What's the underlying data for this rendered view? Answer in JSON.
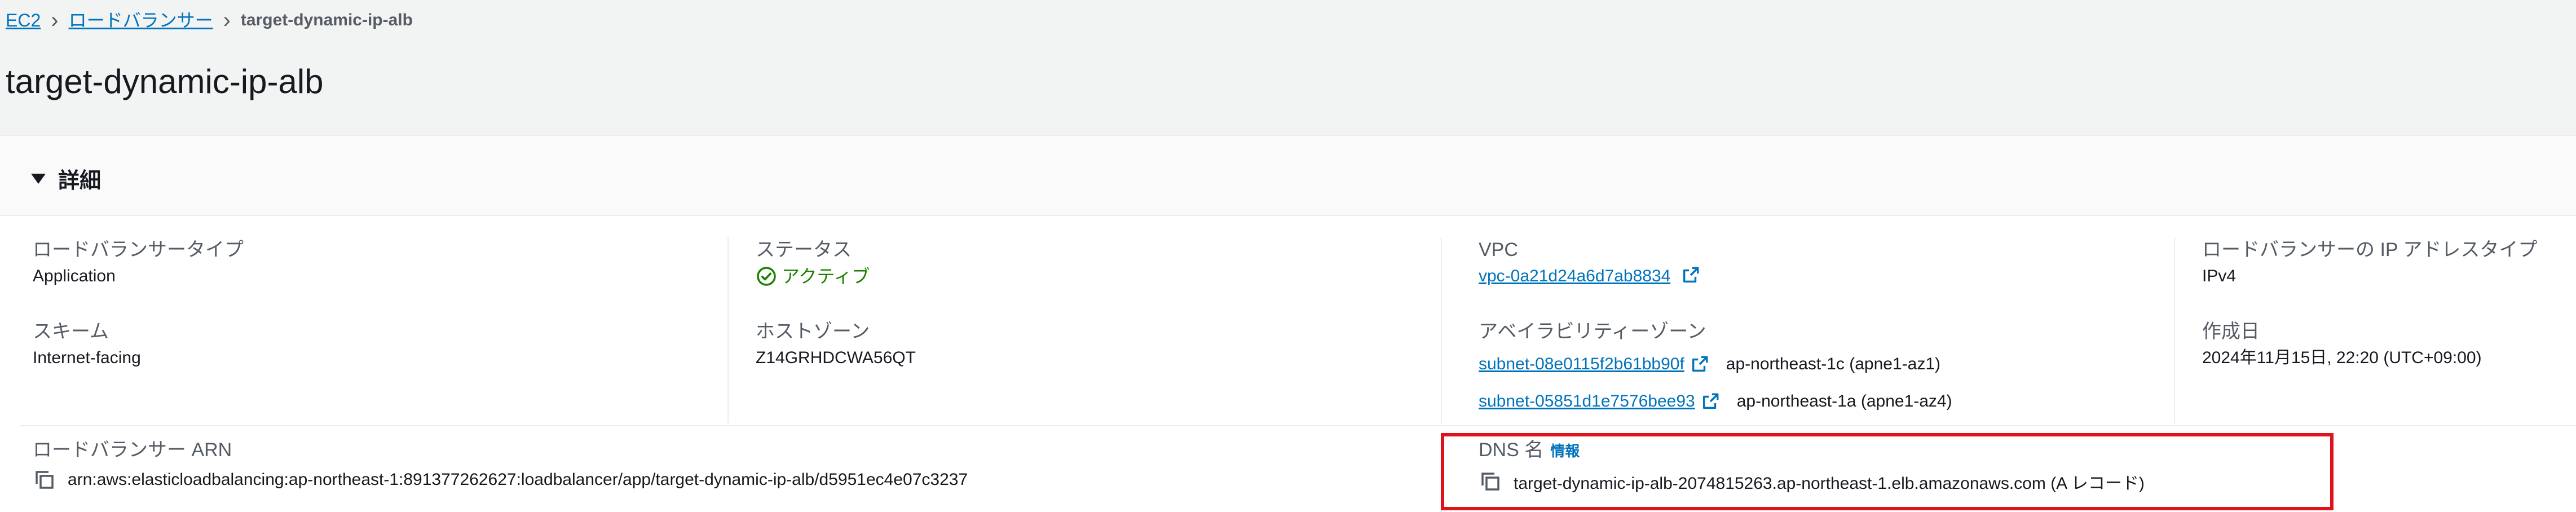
{
  "breadcrumb": {
    "items": [
      "EC2",
      "ロードバランサー"
    ],
    "current": "target-dynamic-ip-alb"
  },
  "page": {
    "title": "target-dynamic-ip-alb"
  },
  "details": {
    "section_title": "詳細",
    "lb_type": {
      "label": "ロードバランサータイプ",
      "value": "Application"
    },
    "scheme": {
      "label": "スキーム",
      "value": "Internet-facing"
    },
    "status": {
      "label": "ステータス",
      "value": "アクティブ",
      "color": "#1d8102"
    },
    "hosted_zone": {
      "label": "ホストゾーン",
      "value": "Z14GRHDCWA56QT"
    },
    "vpc": {
      "label": "VPC",
      "value": "vpc-0a21d24a6d7ab8834"
    },
    "availability_zones": {
      "label": "アベイラビリティーゾーン",
      "items": [
        {
          "subnet": "subnet-08e0115f2b61bb90f",
          "zone": "ap-northeast-1c (apne1-az1)"
        },
        {
          "subnet": "subnet-05851d1e7576bee93",
          "zone": "ap-northeast-1a (apne1-az4)"
        }
      ]
    },
    "ip_address_type": {
      "label": "ロードバランサーの IP アドレスタイプ",
      "value": "IPv4"
    },
    "created": {
      "label": "作成日",
      "value": "2024年11月15日, 22:20 (UTC+09:00)"
    },
    "arn": {
      "label": "ロードバランサー ARN",
      "value": "arn:aws:elasticloadbalancing:ap-northeast-1:891377262627:loadbalancer/app/target-dynamic-ip-alb/d5951ec4e07c3237"
    },
    "dns": {
      "label": "DNS 名",
      "info": "情報",
      "value": "target-dynamic-ip-alb-2074815263.ap-northeast-1.elb.amazonaws.com (A レコード)"
    }
  },
  "colors": {
    "link": "#0073bb",
    "highlight": "#e0121b",
    "background": "#f2f3f3"
  },
  "icons": [
    "chevron-right-icon",
    "caret-down-icon",
    "check-circle-icon",
    "external-link-icon",
    "copy-icon"
  ]
}
